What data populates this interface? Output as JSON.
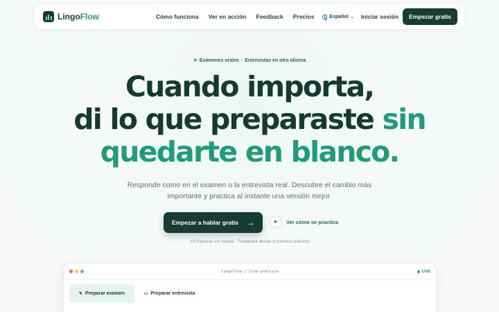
{
  "nav": {
    "logo_main": "Lingo",
    "logo_accent": "Flow",
    "links": [
      "Cómo funciona",
      "Ver en acción",
      "Feedback",
      "Precios"
    ],
    "language": "Español",
    "login": "Iniciar sesión",
    "cta": "Empezar gratis"
  },
  "badge": {
    "item1": "Exámenes orales",
    "separator": "·",
    "item2": "Entrevistas en otro idioma"
  },
  "hero": {
    "line1": "Cuando importa,",
    "line2_main": "di lo que preparaste ",
    "line2_accent": "sin",
    "line3_accent": "quedarte en blanco."
  },
  "subtitle": {
    "line1": "Responde como en el examen o la entrevista real. Descubre el cambio más",
    "line2": "importante y practica al instante una versión mejor."
  },
  "cta": {
    "primary": "Empezar a hablar gratis",
    "primary_arrow": "→",
    "secondary": "Ver cómo se practica"
  },
  "fine_print": {
    "check": "✓",
    "item1": "Empiezas sin tarjeta",
    "separator": "·",
    "item2": "Feedback desde la primera práctica"
  },
  "preview": {
    "window_title": "lingoflow / live practice",
    "live_label": "LIVE",
    "tabs": [
      {
        "label": "Preparar examen",
        "icon": "pen-icon"
      },
      {
        "label": "Preparar entrevista",
        "icon": "briefcase-icon"
      }
    ]
  },
  "colors": {
    "brand_dark": "#173c35",
    "accent_green": "#1f9c78",
    "window_dot_red": "#ee6a5f",
    "window_dot_yellow": "#f5bf4f",
    "window_dot_green": "#61c554"
  }
}
